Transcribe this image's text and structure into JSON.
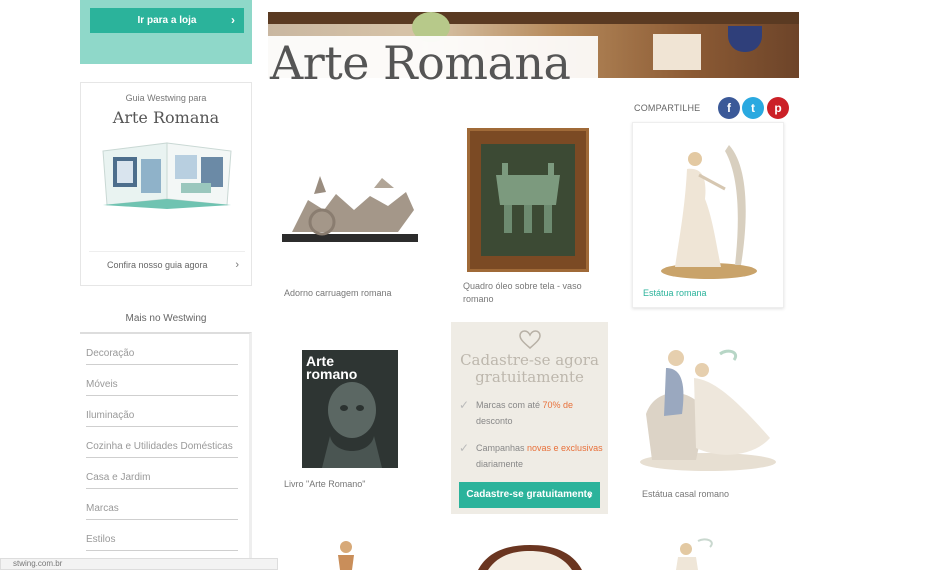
{
  "sidebar": {
    "promo_button": "Ir para a loja",
    "guide": {
      "pre": "Guia Westwing para",
      "title": "Arte Romana",
      "link": "Confira nosso guia agora"
    },
    "more_title": "Mais no Westwing",
    "more_items": [
      "Decoração",
      "Móveis",
      "Iluminação",
      "Cozinha e Utilidades Domésticas",
      "Casa e Jardim",
      "Marcas",
      "Estilos"
    ]
  },
  "status_bar": "stwing.com.br",
  "hero": {
    "title": "Arte Romana"
  },
  "share": {
    "label": "COMPARTILHE",
    "facebook": "f",
    "twitter": "t",
    "pinterest": "p"
  },
  "products": [
    {
      "caption": "Adorno carruagem romana"
    },
    {
      "caption": "Quadro óleo sobre tela - vaso romano"
    },
    {
      "caption": "Estátua romana"
    },
    {
      "caption": "Livro \"Arte Romano\""
    },
    {
      "caption": "Estátua casal romano"
    }
  ],
  "book_cover": {
    "line1": "Arte",
    "line2": "romano"
  },
  "signup": {
    "title": "Cadastre-se agora gratuitamente",
    "item1_pre": "Marcas com até ",
    "item1_hl": "70% de",
    "item1_post": "desconto",
    "item2_pre": "Campanhas ",
    "item2_hl": "novas e exclusivas",
    "item2_post": " diariamente",
    "button": "Cadastre-se gratuitamente"
  },
  "colors": {
    "accent": "#2bb39b",
    "promo_bg": "#8fd8c9",
    "highlight": "#e8703a",
    "signup_bg": "#efece5"
  },
  "icons": {
    "chevron": "chevron-right-icon",
    "check": "check-icon",
    "heart": "heart-icon",
    "facebook": "facebook-icon",
    "twitter": "twitter-icon",
    "pinterest": "pinterest-icon"
  }
}
